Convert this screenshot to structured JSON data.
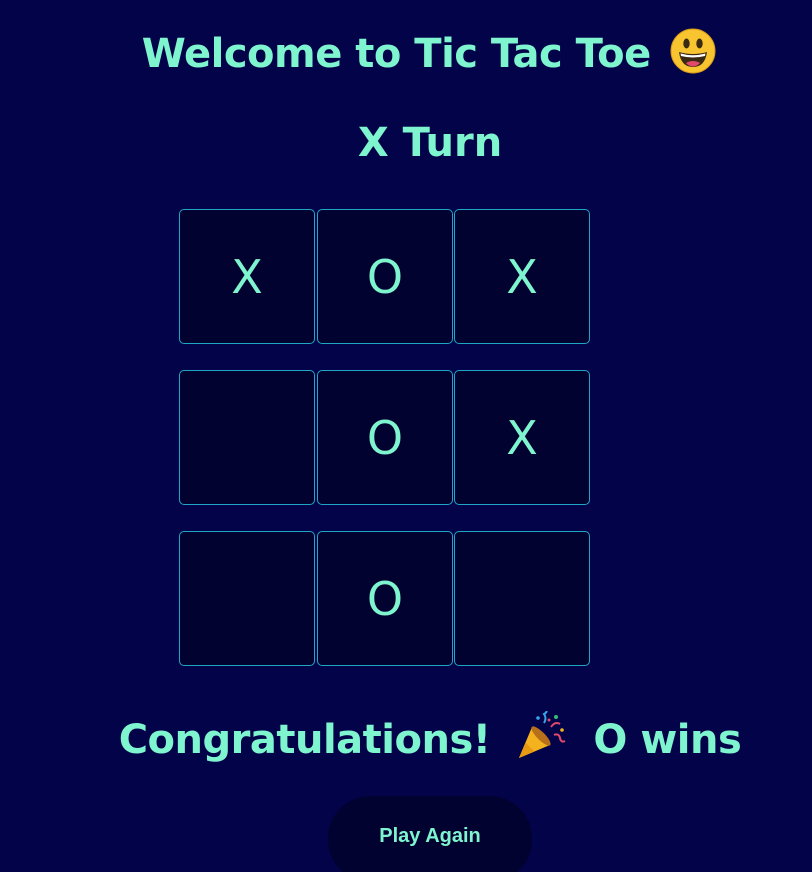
{
  "header": {
    "title": "Welcome to Tic Tac Toe",
    "title_emoji": "grinning-face-emoji"
  },
  "status": {
    "turn": "X Turn"
  },
  "board": {
    "cells": [
      "X",
      "O",
      "X",
      "",
      "O",
      "X",
      "",
      "O",
      ""
    ]
  },
  "result": {
    "message_prefix": "Congratulations!",
    "message_emoji": "party-popper-emoji",
    "message_suffix": "O wins"
  },
  "actions": {
    "play_again_label": "Play Again"
  },
  "colors": {
    "background": "#03034a",
    "text": "#7ff5cf",
    "cell_background": "#020231",
    "cell_border": "#1fa6c4"
  }
}
